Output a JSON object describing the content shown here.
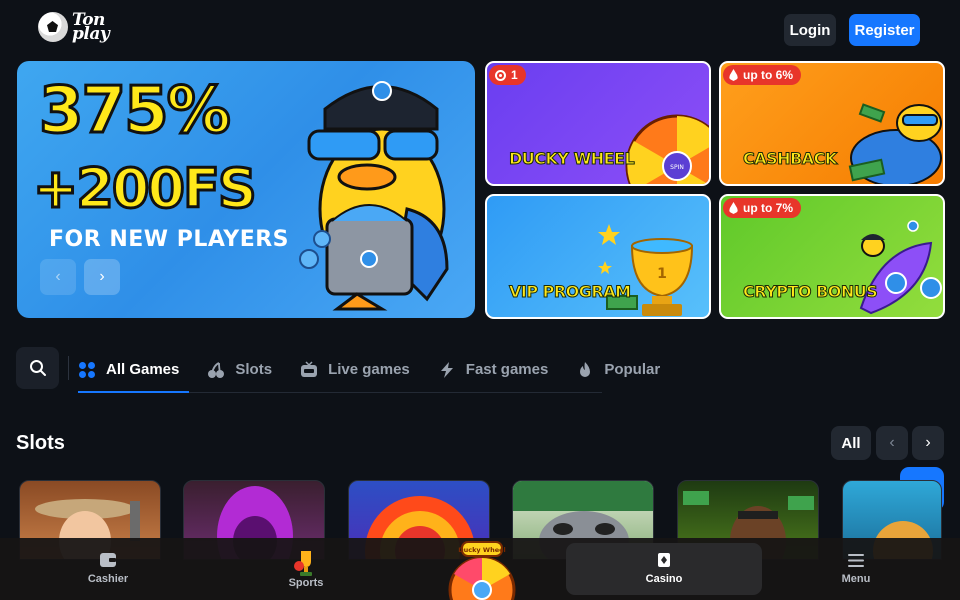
{
  "header": {
    "logo_text": "Ton play",
    "login_label": "Login",
    "register_label": "Register"
  },
  "hero": {
    "headline": "375%",
    "subheadline": "+200FS",
    "tagline": "FOR NEW PLAYERS",
    "prev_icon": "‹",
    "next_icon": "›"
  },
  "promos": [
    {
      "title": "DUCKY WHEEL",
      "badge": "1",
      "badge_icon": "record-icon",
      "wheel_label": "SPIN"
    },
    {
      "title": "CASHBACK",
      "badge": "up to 6%",
      "badge_icon": "flame-icon"
    },
    {
      "title": "VIP PROGRAM",
      "badge": "",
      "cup_label": "1"
    },
    {
      "title": "CRYPTO BONUS",
      "badge": "up to 7%",
      "badge_icon": "flame-icon"
    }
  ],
  "tabs": [
    {
      "label": "All Games",
      "icon": "grid-icon",
      "active": true
    },
    {
      "label": "Slots",
      "icon": "cherries-icon",
      "active": false
    },
    {
      "label": "Live games",
      "icon": "live-tv-icon",
      "active": false
    },
    {
      "label": "Fast games",
      "icon": "lightning-icon",
      "active": false
    },
    {
      "label": "Popular",
      "icon": "flame-icon",
      "active": false
    }
  ],
  "slots": {
    "title": "Slots",
    "all_label": "All",
    "prev_icon": "‹",
    "next_icon": "›"
  },
  "bottom_nav": [
    {
      "label": "Cashier",
      "icon": "wallet-icon"
    },
    {
      "label": "Sports",
      "icon": "trophy-icon"
    },
    {
      "label": "Casino",
      "icon": "cards-icon",
      "active": true
    },
    {
      "label": "Menu",
      "icon": "hamburger-icon"
    }
  ],
  "wheel_fab_label": "Ducky Wheel",
  "colors": {
    "background": "#0d1117",
    "accent": "#1677ff",
    "highlight_yellow": "#ffe81a",
    "badge_red": "#e8352a"
  }
}
